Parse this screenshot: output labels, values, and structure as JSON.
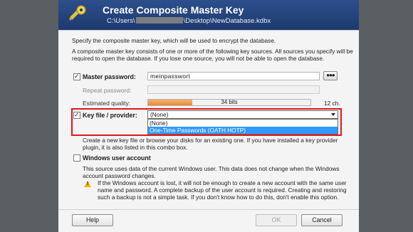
{
  "banner": {
    "title": "Create Composite Master Key",
    "path_prefix": "C:\\Users\\",
    "path_suffix": "\\Desktop\\NewDatabase.kdbx"
  },
  "intro": {
    "line1": "Specify the composite master key, which will be used to encrypt the database.",
    "line2": "A composite master key consists of one or more of the following key sources. All sources you specify will be required to open the database.  If you lose one source, you will not be able to open the database."
  },
  "master_password": {
    "checked": true,
    "label": "Master password:",
    "value": "meinpasswort",
    "reveal_button": "●●●",
    "repeat_label": "Repeat password:",
    "repeat_value": "",
    "quality_label": "Estimated quality:",
    "quality_bits": "34 bits",
    "quality_fraction": 0.27,
    "length": "12 ch."
  },
  "key_file": {
    "checked": true,
    "label": "Key file / provider:",
    "selected": "(None)",
    "options": [
      "(None)",
      "One-Time Passwords (OATH HOTP)"
    ],
    "highlighted_index": 1,
    "description": "Create a new key file or browse your disks for an existing one. If you have installed a key provider plugin, it is also listed in this combo box."
  },
  "windows_account": {
    "checked": false,
    "label": "Windows user account",
    "description": "This source uses data of the current Windows user. This data does not change when the Windows account password changes.",
    "warning": "If the Windows account is lost, it will not be enough to create a new account with the same user name and password. A complete backup of the user account is required. Creating and restoring such a backup is not a simple task. If you don't know how to do this, don't enable this option."
  },
  "footer": {
    "help": "Help",
    "ok": "OK",
    "cancel": "Cancel"
  },
  "colors": {
    "banner": "#2c4f8c",
    "highlight_box": "#e01818",
    "selection": "#3399ff",
    "quality_fill": "#e98a2e"
  }
}
